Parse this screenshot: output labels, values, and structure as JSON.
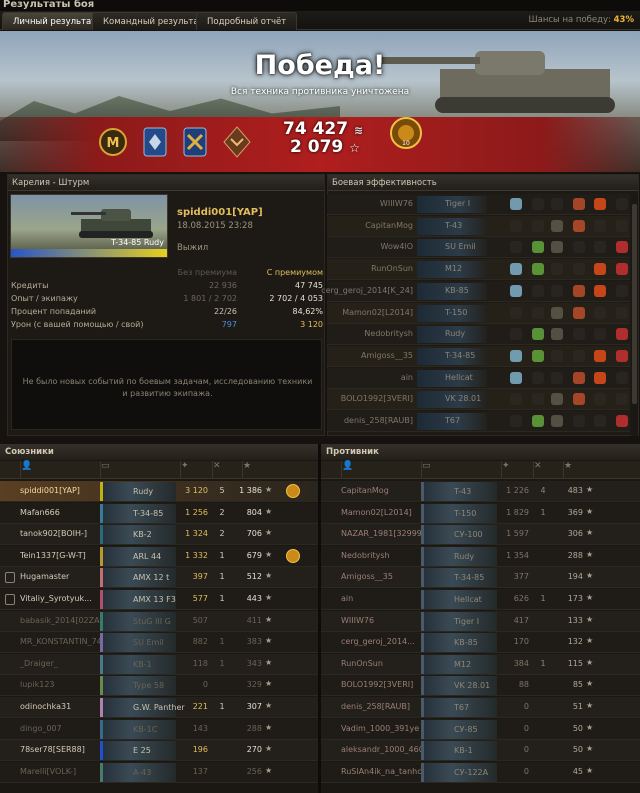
{
  "window": {
    "title": "Результаты боя"
  },
  "tabs": [
    {
      "label": "Личный результат",
      "active": true
    },
    {
      "label": "Командный результат",
      "active": false
    },
    {
      "label": "Подробный отчёт",
      "active": false
    }
  ],
  "chance": {
    "label": "Шансы на победу:",
    "value": "43%"
  },
  "banner": {
    "result": "Победа!",
    "subtitle": "Вся техника противника уничтожена",
    "credits": "74 427",
    "xp": "2 079"
  },
  "personal": {
    "header": "Карелия - Штурм",
    "player": "spiddi001[YAP]",
    "datetime": "18.08.2015 23:28",
    "status": "Выжил",
    "tank": "T-34-85 Rudy",
    "col_no_prem": "Без премиума",
    "col_prem": "С премиумом",
    "rows": [
      {
        "label": "Кредиты",
        "no_prem": "22 936",
        "prem": "47 745"
      },
      {
        "label": "Опыт / экипажу",
        "no_prem": "1 801 / 2 702",
        "prem": "2 702 / 4 053"
      },
      {
        "label": "Процент попаданий",
        "no_prem": "22/26",
        "prem": "84,62%"
      },
      {
        "label": "Урон (с вашей помощью / свой)",
        "no_prem": "797",
        "prem": "3 120"
      }
    ],
    "message": "Не было новых событий по боевым задачам, исследованию техники и развитию экипажа."
  },
  "efficiency": {
    "header": "Боевая эффективность",
    "rows": [
      {
        "name": "WIIIW76",
        "tank": "Tiger I"
      },
      {
        "name": "CapitanMog",
        "tank": "T-43"
      },
      {
        "name": "Wow4lO",
        "tank": "SU Emil"
      },
      {
        "name": "RunOnSun",
        "tank": "M12"
      },
      {
        "name": "cerg_geroj_2014[K_24]",
        "tank": "KB-85"
      },
      {
        "name": "Mamon02[L2014]",
        "tank": "T-150"
      },
      {
        "name": "Nedobritysh",
        "tank": "Rudy"
      },
      {
        "name": "Amigoss__35",
        "tank": "T-34-85"
      },
      {
        "name": "ain",
        "tank": "Hellcat"
      },
      {
        "name": "BOLO1992[3VERI]",
        "tank": "VK 28.01"
      },
      {
        "name": "denis_258[RAUB]",
        "tank": "T67"
      }
    ]
  },
  "allies": {
    "header": "Союзники",
    "players": [
      {
        "name": "spiddi001[YAP]",
        "tank": "Rudy",
        "dmg": "3 120",
        "kills": "5",
        "xp": "1 386",
        "me": true,
        "dead": false
      },
      {
        "name": "Mafan666",
        "tank": "T-34-85",
        "dmg": "1 256",
        "kills": "2",
        "xp": "804",
        "dead": false
      },
      {
        "name": "tanok902[BOIH-]",
        "tank": "KB-2",
        "dmg": "1 324",
        "kills": "2",
        "xp": "706",
        "dead": false
      },
      {
        "name": "Tein1337[G-W-T]",
        "tank": "ARL 44",
        "dmg": "1 332",
        "kills": "1",
        "xp": "679",
        "dead": false
      },
      {
        "name": "Hugamaster",
        "tank": "AMX 12 t",
        "dmg": "397",
        "kills": "1",
        "xp": "512",
        "dead": false
      },
      {
        "name": "Vitaliy_Syrotyuk...",
        "tank": "AMX 13 F3",
        "dmg": "577",
        "kills": "1",
        "xp": "443",
        "dead": false
      },
      {
        "name": "babasik_2014[02ZAF]",
        "tank": "StuG III G",
        "dmg": "507",
        "kills": "",
        "xp": "411",
        "dead": true
      },
      {
        "name": "MR_KONSTANTIN_74",
        "tank": "SU Emil",
        "dmg": "882",
        "kills": "1",
        "xp": "383",
        "dead": true
      },
      {
        "name": "_Draiger_",
        "tank": "KB-1",
        "dmg": "118",
        "kills": "1",
        "xp": "343",
        "dead": true
      },
      {
        "name": "lupik123",
        "tank": "Type 58",
        "dmg": "0",
        "kills": "",
        "xp": "329",
        "dead": true
      },
      {
        "name": "odinochka31",
        "tank": "G.W. Panther",
        "dmg": "221",
        "kills": "1",
        "xp": "307",
        "dead": false
      },
      {
        "name": "dingo_007",
        "tank": "KB-1C",
        "dmg": "143",
        "kills": "",
        "xp": "288",
        "dead": true
      },
      {
        "name": "78ser78[SER88]",
        "tank": "E 25",
        "dmg": "196",
        "kills": "",
        "xp": "270",
        "dead": false
      },
      {
        "name": "Marelli[VOLK-]",
        "tank": "A-43",
        "dmg": "137",
        "kills": "",
        "xp": "256",
        "dead": true
      }
    ]
  },
  "enemies": {
    "header": "Противник",
    "players": [
      {
        "name": "CapitanMog",
        "tank": "T-43",
        "dmg": "1 226",
        "kills": "4",
        "xp": "483"
      },
      {
        "name": "Mamon02[L2014]",
        "tank": "T-150",
        "dmg": "1 829",
        "kills": "1",
        "xp": "369"
      },
      {
        "name": "NAZAR_1981[32999]",
        "tank": "СУ-100",
        "dmg": "1 597",
        "kills": "",
        "xp": "306"
      },
      {
        "name": "Nedobritysh",
        "tank": "Rudy",
        "dmg": "1 354",
        "kills": "",
        "xp": "288"
      },
      {
        "name": "Amigoss__35",
        "tank": "T-34-85",
        "dmg": "377",
        "kills": "",
        "xp": "194"
      },
      {
        "name": "ain",
        "tank": "Hellcat",
        "dmg": "626",
        "kills": "1",
        "xp": "173"
      },
      {
        "name": "WIIIW76",
        "tank": "Tiger I",
        "dmg": "417",
        "kills": "",
        "xp": "133"
      },
      {
        "name": "cerg_geroj_2014...",
        "tank": "KB-85",
        "dmg": "170",
        "kills": "",
        "xp": "132"
      },
      {
        "name": "RunOnSun",
        "tank": "M12",
        "dmg": "384",
        "kills": "1",
        "xp": "115"
      },
      {
        "name": "BOLO1992[3VERI]",
        "tank": "VK 28.01",
        "dmg": "88",
        "kills": "",
        "xp": "85"
      },
      {
        "name": "denis_258[RAUB]",
        "tank": "T67",
        "dmg": "0",
        "kills": "",
        "xp": "51"
      },
      {
        "name": "Vadim_1000_391ye",
        "tank": "СУ-85",
        "dmg": "0",
        "kills": "",
        "xp": "50"
      },
      {
        "name": "aleksandr_1000_460",
        "tank": "KB-1",
        "dmg": "0",
        "kills": "",
        "xp": "50"
      },
      {
        "name": "RuSlAn4ik_na_tanhci...",
        "tank": "СУ-122A",
        "dmg": "0",
        "kills": "",
        "xp": "45"
      }
    ]
  },
  "colors": {
    "accent": "#e2bd5c",
    "chance": "#f0b530",
    "victory_band": "#b01e1e"
  }
}
